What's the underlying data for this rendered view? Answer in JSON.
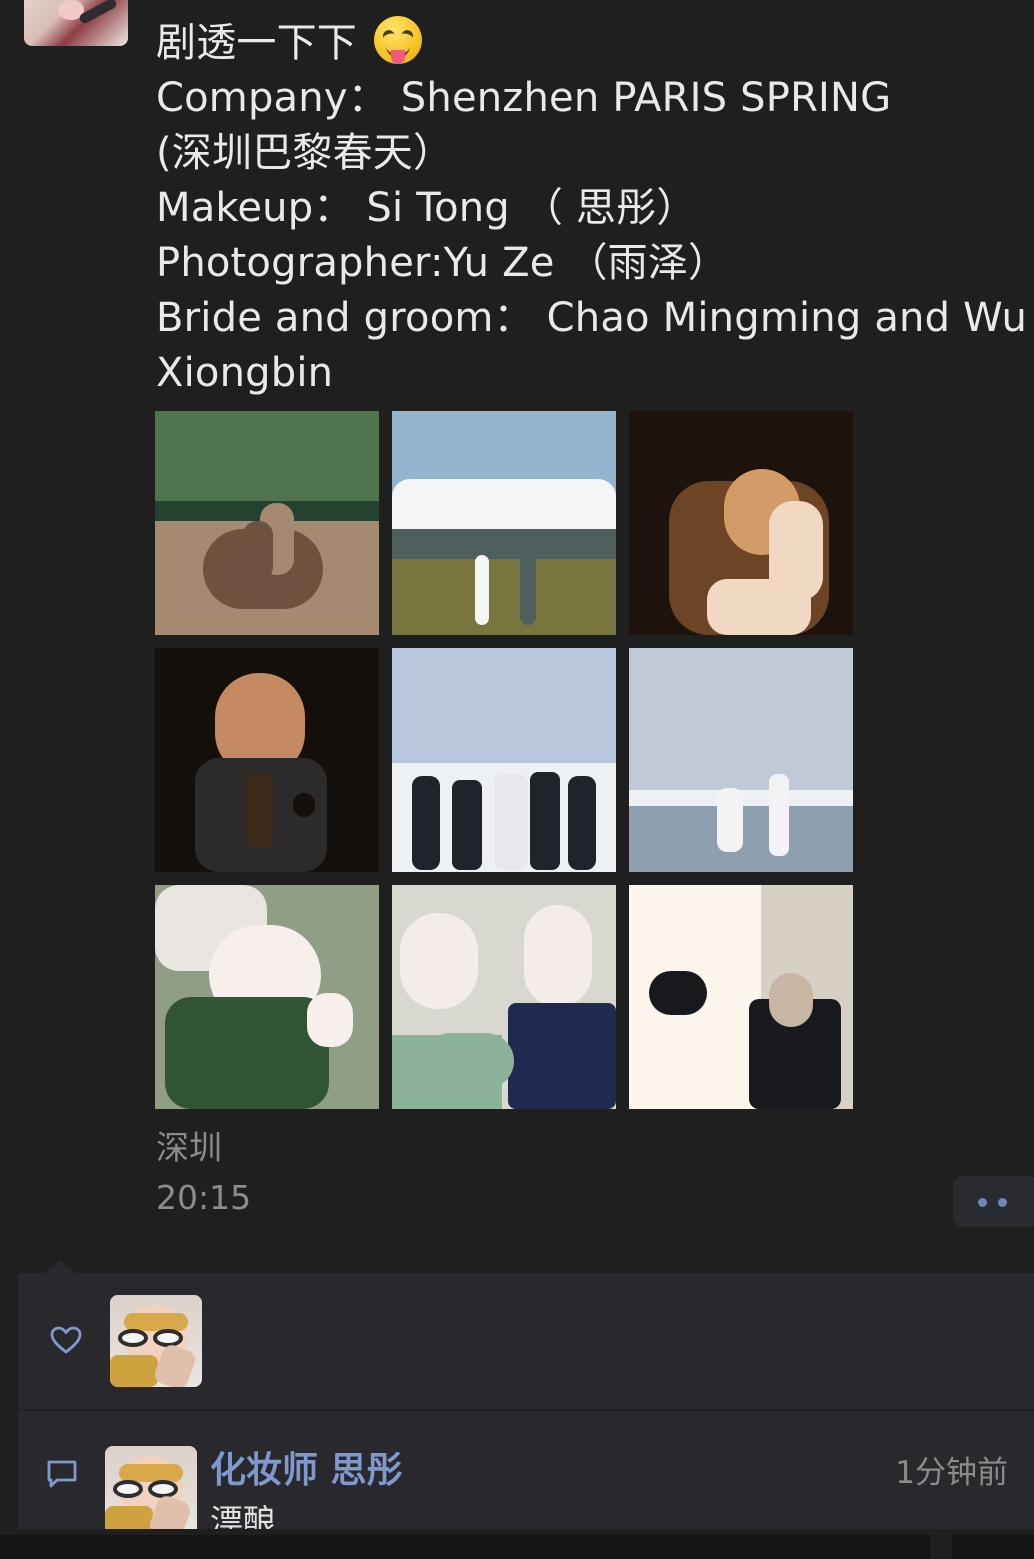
{
  "post": {
    "lines": [
      "剧透一下下",
      "Company：  Shenzhen PARIS SPRING",
      "(深圳巴黎春天）",
      "Makeup：  Si Tong （ 思彤）",
      "Photographer:Yu Ze  （雨泽）",
      "Bride and groom：  Chao Mingming and Wu",
      "Xiongbin"
    ],
    "emoji": "squinting-face-with-tongue-icon",
    "location": "深圳",
    "time": "20:15"
  },
  "photos": [
    {
      "name": "photo-couple-in-basket",
      "colors": [
        "#254231",
        "#50754e",
        "#a38a71",
        "#6c523f"
      ]
    },
    {
      "name": "photo-mountain-field",
      "colors": [
        "#93b4ce",
        "#f3f5f6",
        "#4f5f5e",
        "#78753f"
      ]
    },
    {
      "name": "photo-bride-portrait-warm",
      "colors": [
        "#1e120d",
        "#6e4427",
        "#d29b67",
        "#f0d8c2"
      ]
    },
    {
      "name": "photo-groom-portrait-warm",
      "colors": [
        "#140f0b",
        "#3b2a1a",
        "#c58a61",
        "#2b2b2c"
      ]
    },
    {
      "name": "photo-group-on-beach",
      "colors": [
        "#b9c6dd",
        "#edf0f5",
        "#20242a",
        "#e9e6ec"
      ]
    },
    {
      "name": "photo-couple-on-beach",
      "colors": [
        "#bfc9d8",
        "#eef1f4",
        "#8ea0ae",
        "#f3f3f6"
      ]
    },
    {
      "name": "photo-bride-with-flower",
      "colors": [
        "#8f9e84",
        "#e9e5e1",
        "#f6efeb",
        "#315534"
      ]
    },
    {
      "name": "photo-couple-selfie",
      "colors": [
        "#d8d8d1",
        "#8db29a",
        "#202a51",
        "#f3ece9"
      ]
    },
    {
      "name": "photo-couple-vintage",
      "colors": [
        "#d7d1c5",
        "#fbf5ee",
        "#17191c",
        "#c8b6a4"
      ]
    }
  ],
  "likes": {
    "icon": "heart-icon",
    "users": [
      "like-user-avatar"
    ]
  },
  "comment": {
    "icon": "comment-icon",
    "author": "化妆师 思彤",
    "time": "1分钟前",
    "text": "漂酿"
  },
  "colors": {
    "background": "#1f1f20",
    "panel": "#29292d",
    "link": "#7f99cf",
    "muted": "#8b8b8b"
  }
}
